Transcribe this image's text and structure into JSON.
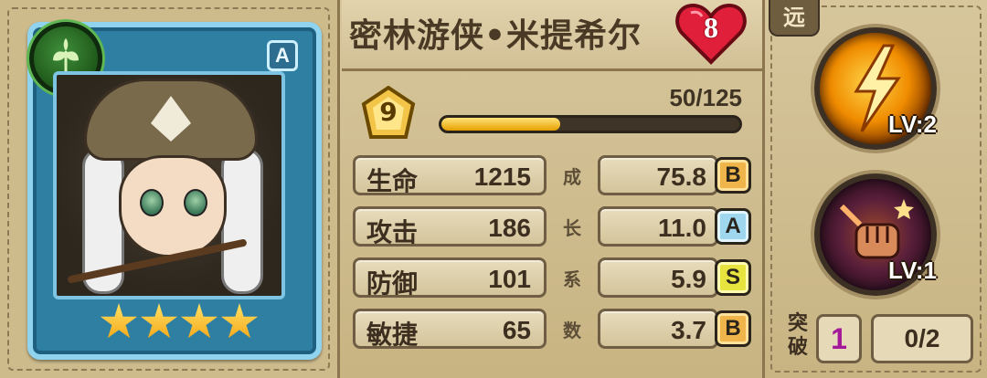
{
  "hero": {
    "name": "密林游侠•米提希尔",
    "rank_letter": "A",
    "heart_number": "8",
    "level": "9",
    "xp_text": "50/125",
    "xp_fraction": 0.4,
    "stars": 4,
    "element_icon": "leaf-icon"
  },
  "stats": [
    {
      "label": "生命",
      "value": "1215",
      "growth_char": "成",
      "growth": "75.8",
      "grade": "B"
    },
    {
      "label": "攻击",
      "value": "186",
      "growth_char": "长",
      "growth": "11.0",
      "grade": "A"
    },
    {
      "label": "防御",
      "value": "101",
      "growth_char": "系",
      "growth": "5.9",
      "grade": "S"
    },
    {
      "label": "敏捷",
      "value": "65",
      "growth_char": "数",
      "growth": "3.7",
      "grade": "B"
    }
  ],
  "skills": {
    "range_tag": "远",
    "items": [
      {
        "icon": "lightning-strike-icon",
        "level": "LV:2"
      },
      {
        "icon": "fist-icon",
        "level": "LV:1"
      }
    ]
  },
  "breakthrough": {
    "label": "突破",
    "count": "1",
    "progress": "0/2"
  },
  "colors": {
    "panel_bg": "#cfbd90",
    "card_frame": "#8fd3ef",
    "xp_fill": "#f0b400",
    "grade_B": "#f0b54a",
    "grade_A": "#9fd7ef",
    "grade_S": "#e7e33f",
    "breakthrough_count": "#a4199a"
  }
}
